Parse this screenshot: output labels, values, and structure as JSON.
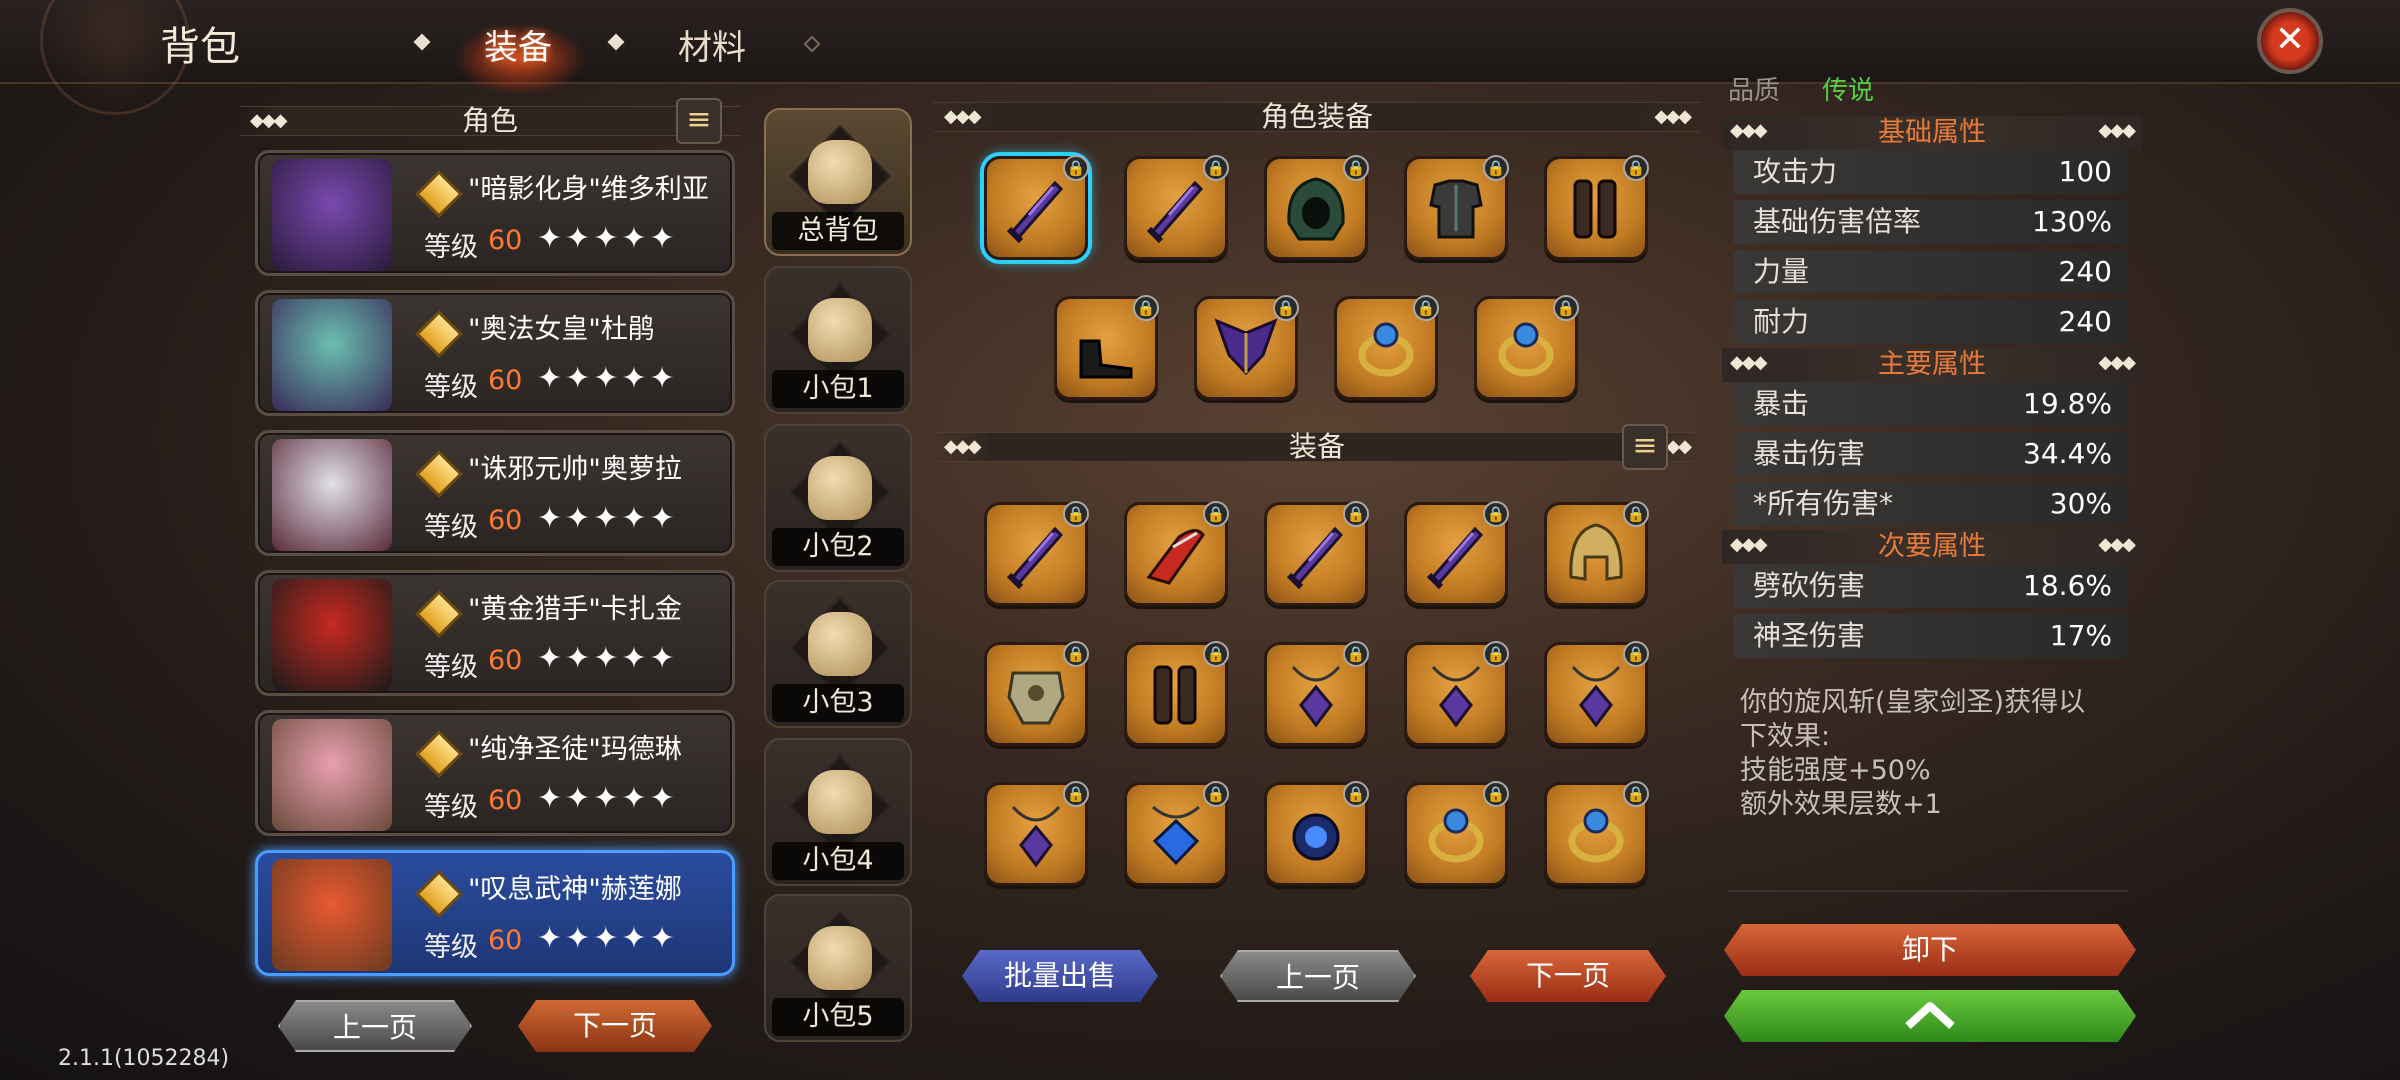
{
  "header": {
    "title": "背包",
    "tabs": [
      "装备",
      "材料"
    ],
    "active_tab": "装备"
  },
  "characters": {
    "header": "角色",
    "list": [
      {
        "name": "\"暗影化身\"维多利亚",
        "level_label": "等级",
        "level": "60",
        "stars": "✦✦✦✦✦",
        "selected": false
      },
      {
        "name": "\"奥法女皇\"杜鹃",
        "level_label": "等级",
        "level": "60",
        "stars": "✦✦✦✦✦",
        "selected": false
      },
      {
        "name": "\"诛邪元帅\"奥萝拉",
        "level_label": "等级",
        "level": "60",
        "stars": "✦✦✦✦✦",
        "selected": false
      },
      {
        "name": "\"黄金猎手\"卡扎金",
        "level_label": "等级",
        "level": "60",
        "stars": "✦✦✦✦✦",
        "selected": false
      },
      {
        "name": "\"纯净圣徒\"玛德琳",
        "level_label": "等级",
        "level": "60",
        "stars": "✦✦✦✦✦",
        "selected": false
      },
      {
        "name": "\"叹息武神\"赫莲娜",
        "level_label": "等级",
        "level": "60",
        "stars": "✦✦✦✦✦",
        "selected": true
      }
    ],
    "prev": "上一页",
    "next": "下一页"
  },
  "bags": [
    "总背包",
    "小包1",
    "小包2",
    "小包3",
    "小包4",
    "小包5"
  ],
  "role_equip": {
    "header": "角色装备",
    "slots": [
      "sword",
      "sword",
      "hood",
      "armor",
      "gauntlet",
      "boots",
      "wings",
      "ring",
      "ring"
    ]
  },
  "equipment": {
    "header": "装备",
    "slots": [
      "sword",
      "cleaver",
      "sword",
      "sword",
      "helmet",
      "chest",
      "gauntlet",
      "pendant",
      "pendant",
      "pendant",
      "pendant",
      "gem",
      "orb",
      "ring",
      "ring"
    ]
  },
  "actions": {
    "batch_sell": "批量出售",
    "prev": "上一页",
    "next": "下一页"
  },
  "stats": {
    "quality_label": "品质",
    "quality_value": "传说",
    "basic_header": "基础属性",
    "basic": [
      {
        "k": "攻击力",
        "v": "100"
      },
      {
        "k": "基础伤害倍率",
        "v": "130%"
      },
      {
        "k": "力量",
        "v": "240"
      },
      {
        "k": "耐力",
        "v": "240"
      }
    ],
    "main_header": "主要属性",
    "main": [
      {
        "k": "暴击",
        "v": "19.8%"
      },
      {
        "k": "暴击伤害",
        "v": "34.4%"
      },
      {
        "k": "*所有伤害*",
        "v": "30%"
      }
    ],
    "secondary_header": "次要属性",
    "secondary": [
      {
        "k": "劈砍伤害",
        "v": "18.6%"
      },
      {
        "k": "神圣伤害",
        "v": "17%"
      }
    ],
    "effect_lines": [
      "你的旋风斩(皇家剑圣)获得以",
      "下效果:",
      "技能强度+50%",
      "额外效果层数+1"
    ],
    "unequip": "卸下",
    "upgrade_icon": "chevron-up-icon"
  },
  "version": "2.1.1(1052284)",
  "colors": {
    "accent": "#ff7a30",
    "selected": "#4b9cff",
    "slot": "#d99434"
  }
}
